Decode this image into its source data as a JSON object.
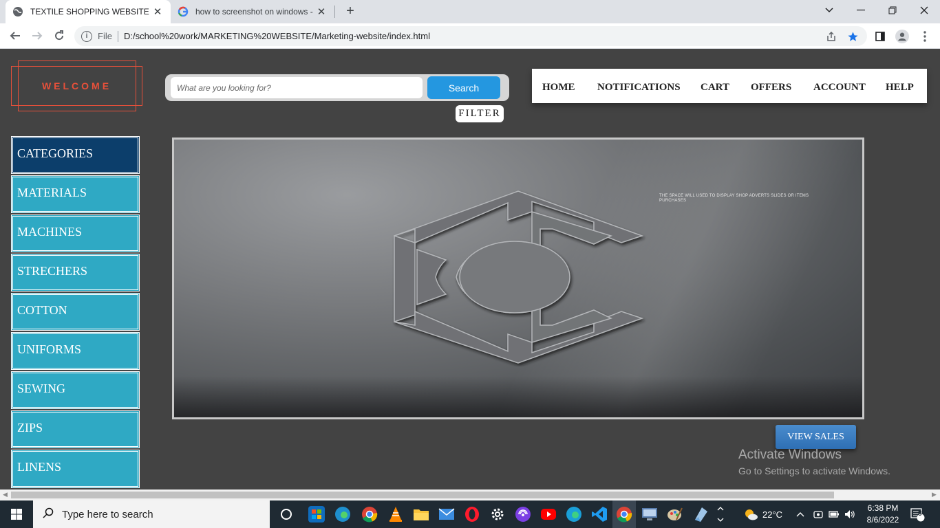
{
  "browser": {
    "tabs": [
      {
        "title": "TEXTILE SHOPPING WEBSITE",
        "active": true
      },
      {
        "title": "how to screenshot on windows -",
        "active": false
      }
    ],
    "new_tab_label": "+",
    "address": {
      "scheme_label": "File",
      "url": "D:/school%20work/MARKETING%20WEBSITE/Marketing-website/index.html"
    },
    "accent_color": "#1a73e8"
  },
  "page": {
    "welcome": "WELCOME",
    "search": {
      "placeholder": "What are you looking for?",
      "button": "Search"
    },
    "filter": "FILTER",
    "nav": [
      "HOME",
      "NOTIFICATIONS",
      "CART",
      "OFFERS",
      "ACCOUNT",
      "HELP"
    ],
    "sidebar": {
      "header": "CATEGORIES",
      "items": [
        "MATERIALS",
        "MACHINES",
        "STRECHERS",
        "COTTON",
        "UNIFORMS",
        "SEWING",
        "ZIPS",
        "LINENS"
      ]
    },
    "banner": {
      "caption": "THE SPACE WILL USED TO DISPLAY SHOP ADVERTS SLIDES OR ITEMS PURCHASES"
    },
    "view_sales": "VIEW SALES",
    "colors": {
      "welcome": "#e8503a",
      "category_header": "#0c3e6b",
      "category_item": "#2fa9c4",
      "search_button": "#2497e0",
      "background": "#434343"
    }
  },
  "watermark": {
    "title": "Activate Windows",
    "subtitle": "Go to Settings to activate Windows."
  },
  "taskbar": {
    "search_placeholder": "Type here to search",
    "weather": "22°C",
    "time": "6:38 PM",
    "date": "8/6/2022",
    "notifications": "8",
    "pinned_icons": [
      "task-view-icon",
      "microsoft-store-icon",
      "edge-icon",
      "chrome-icon",
      "vlc-icon",
      "file-explorer-icon",
      "mail-icon",
      "opera-icon",
      "settings-icon",
      "podcast-icon",
      "youtube-icon",
      "edge-beta-icon",
      "vscode-icon",
      "chrome-active-icon",
      "remote-desktop-icon",
      "paint-icon",
      "notes-icon"
    ]
  }
}
